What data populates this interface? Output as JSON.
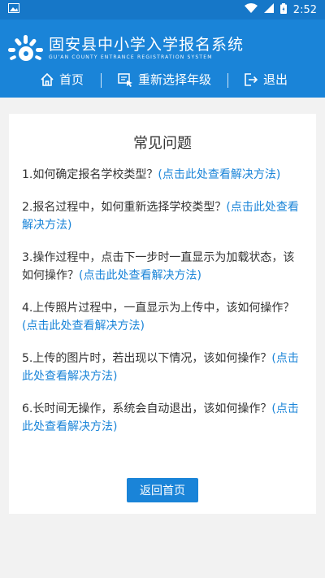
{
  "status_bar": {
    "time": "2:52"
  },
  "header": {
    "title": "固安县中小学入学报名系统",
    "subtitle": "GU'AN COUNTY ENTRANCE REGISTRATION SYSTEM"
  },
  "nav": {
    "home": "首页",
    "reselect": "重新选择年级",
    "logout": "退出"
  },
  "content": {
    "title": "常见问题",
    "faq": [
      {
        "question": "1.如何确定报名学校类型？",
        "link": "(点击此处查看解决方法)"
      },
      {
        "question": "2.报名过程中，如何重新选择学校类型？",
        "link": "(点击此处查看解决方法)"
      },
      {
        "question": "3.操作过程中，点击下一步时一直显示为加载状态，该如何操作？",
        "link": "(点击此处查看解决方法)"
      },
      {
        "question": "4.上传照片过程中，一直显示为上传中，该如何操作？",
        "link": "(点击此处查看解决方法)"
      },
      {
        "question": "5.上传的图片时，若出现以下情况，该如何操作？",
        "link": "(点击此处查看解决方法)"
      },
      {
        "question": "6.长时间无操作，系统会自动退出，该如何操作？",
        "link": "(点击此处查看解决方法)"
      }
    ],
    "back_button": "返回首页"
  },
  "colors": {
    "primary": "#1a84d8",
    "status_bar": "#1677c8",
    "background": "#f2f2f2"
  }
}
